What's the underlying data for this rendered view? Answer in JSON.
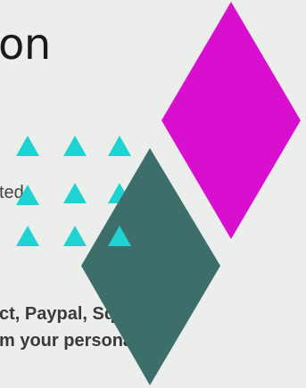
{
  "slide": {
    "title_fragment": "on",
    "body_fragment": "ted",
    "bold_lines": [
      "ct, Paypal, Square)",
      "m your personal"
    ]
  },
  "colors": {
    "background": "#eceeeb",
    "magenta_diamond": "#d90fcf",
    "teal_diamond": "#3e6e6c",
    "triangles": "#1fd3d3",
    "title_text": "#1a1a1a",
    "body_text": "#444444"
  },
  "decor": {
    "triangle_icon": "up-triangle-icon",
    "diamond_icon": "diamond-icon"
  }
}
